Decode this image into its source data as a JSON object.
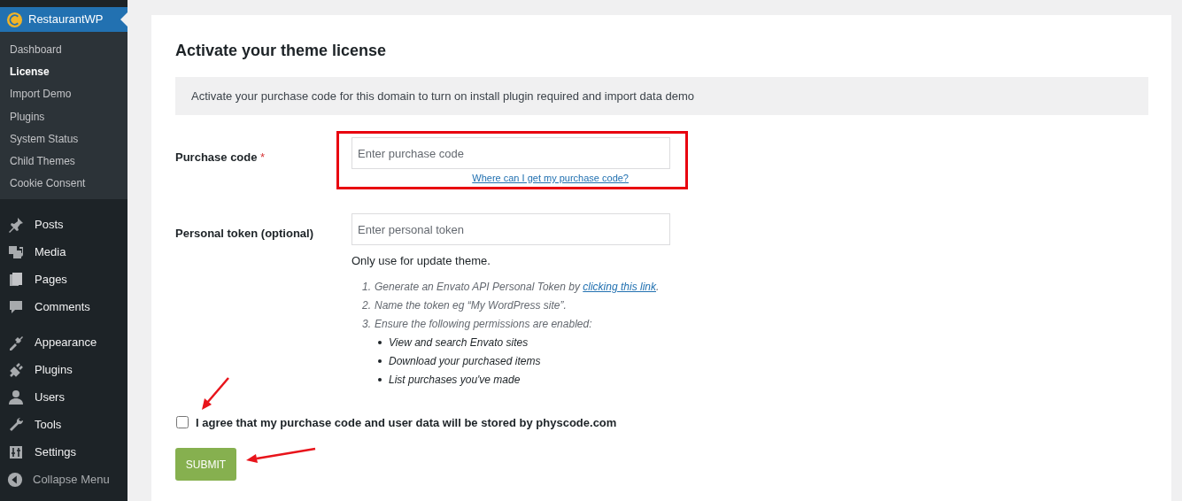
{
  "sidebar": {
    "plugin_menu": {
      "title": "RestaurantWP",
      "items": [
        {
          "label": "Dashboard",
          "selected": false
        },
        {
          "label": "License",
          "selected": true
        },
        {
          "label": "Import Demo",
          "selected": false
        },
        {
          "label": "Plugins",
          "selected": false
        },
        {
          "label": "System Status",
          "selected": false
        },
        {
          "label": "Child Themes",
          "selected": false
        },
        {
          "label": "Cookie Consent",
          "selected": false
        }
      ]
    },
    "menu_groups": [
      [
        {
          "label": "Posts",
          "kind": "posts"
        },
        {
          "label": "Media",
          "kind": "media"
        },
        {
          "label": "Pages",
          "kind": "pages"
        },
        {
          "label": "Comments",
          "kind": "comments"
        }
      ],
      [
        {
          "label": "Appearance",
          "kind": "appearance"
        },
        {
          "label": "Plugins",
          "kind": "plugins"
        },
        {
          "label": "Users",
          "kind": "users"
        },
        {
          "label": "Tools",
          "kind": "tools"
        },
        {
          "label": "Settings",
          "kind": "settings"
        }
      ]
    ],
    "collapse": "Collapse Menu"
  },
  "page": {
    "title": "Activate your theme license",
    "notice": "Activate your purchase code for this domain to turn on install plugin required and import data demo",
    "fields": [
      {
        "label": "Purchase code",
        "required_mark": "*",
        "placeholder": "Enter purchase code",
        "help_link": "Where can I get my purchase code?",
        "highlighted": true
      },
      {
        "label": "Personal token (optional)",
        "placeholder": "Enter personal token",
        "note": "Only use for update theme.",
        "highlighted": false
      }
    ],
    "steps": [
      {
        "number": "1.",
        "text": "Generate an Envato API Personal Token by ",
        "link": "clicking this link",
        "tail": "."
      },
      {
        "number": "2.",
        "text": "Name the token eg “My WordPress site”."
      },
      {
        "number": "3.",
        "text": "Ensure the following permissions are enabled:"
      }
    ],
    "permissions": [
      "View and search Envato sites",
      "Download your purchased items",
      "List purchases you've made"
    ],
    "agreement": {
      "label": "I agree that my purchase code and user data will be stored by physcode.com",
      "checked": false
    },
    "submit": "SUBMIT"
  }
}
